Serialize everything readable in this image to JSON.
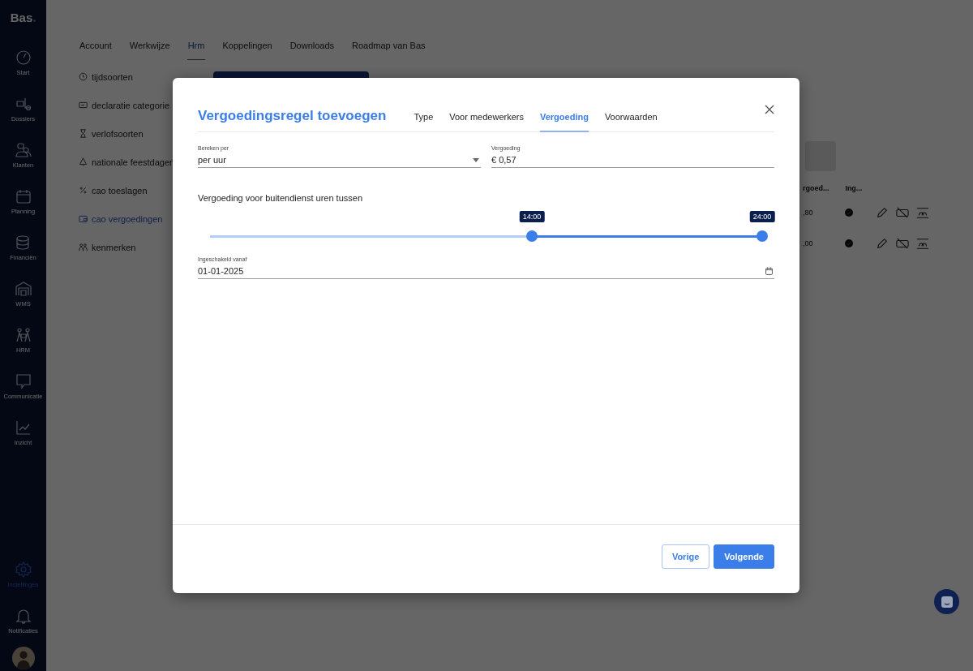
{
  "sidebar": {
    "logo": "Bas",
    "items": [
      {
        "label": "Start",
        "selected": false
      },
      {
        "label": "Dossiers",
        "selected": false
      },
      {
        "label": "Klanten",
        "selected": false
      },
      {
        "label": "Planning",
        "selected": false
      },
      {
        "label": "Financiën",
        "selected": false
      },
      {
        "label": "WMS",
        "selected": false
      },
      {
        "label": "HRM",
        "selected": false
      },
      {
        "label": "Communicatie",
        "selected": false
      },
      {
        "label": "Inzicht",
        "selected": false
      }
    ],
    "bottom_items": [
      {
        "label": "Instellingen",
        "selected": true
      },
      {
        "label": "Notificaties",
        "selected": false
      }
    ]
  },
  "top_tabs": [
    {
      "label": "Account",
      "selected": false
    },
    {
      "label": "Werkwijze",
      "selected": false
    },
    {
      "label": "Hrm",
      "selected": true
    },
    {
      "label": "Koppelingen",
      "selected": false
    },
    {
      "label": "Downloads",
      "selected": false
    },
    {
      "label": "Roadmap van Bas",
      "selected": false
    }
  ],
  "settings_menu": [
    {
      "label": "tijdsoorten",
      "selected": false
    },
    {
      "label": "declaratie categorie",
      "selected": false
    },
    {
      "label": "verlofsoorten",
      "selected": false
    },
    {
      "label": "nationale feestdagen",
      "selected": false
    },
    {
      "label": "cao toeslagen",
      "selected": false
    },
    {
      "label": "cao vergoedingen",
      "selected": true
    },
    {
      "label": "kenmerken",
      "selected": false
    }
  ],
  "table": {
    "columns": [
      "rgoed...",
      "Ing..."
    ],
    "rows": [
      {
        "cells": [
          ",80"
        ],
        "enabled": true
      },
      {
        "cells": [
          ",00"
        ],
        "enabled": true
      }
    ]
  },
  "dialog": {
    "title": "Vergoedingsregel toevoegen",
    "steps": [
      {
        "label": "Type",
        "selected": false
      },
      {
        "label": "Voor medewerkers",
        "selected": false
      },
      {
        "label": "Vergoeding",
        "selected": true
      },
      {
        "label": "Voorwaarden",
        "selected": false
      }
    ],
    "fields": [
      {
        "label": "Bereken per",
        "value": "per uur",
        "kind": "select"
      },
      {
        "label": "Vergoeding",
        "value": "€ 0,57",
        "kind": "text"
      }
    ],
    "range_label": "Vergoeding voor buitendienst uren tussen",
    "range_handles": [
      {
        "level": 0.583,
        "reading": "14:00"
      },
      {
        "level": 1,
        "reading": "24:00"
      }
    ],
    "date_field": {
      "label": "Ingeschakeld vanaf",
      "value": "01-01-2025"
    },
    "buttons": [
      {
        "label": "Vorige",
        "kind": "secondary"
      },
      {
        "label": "Volgende",
        "kind": "primary"
      }
    ]
  }
}
